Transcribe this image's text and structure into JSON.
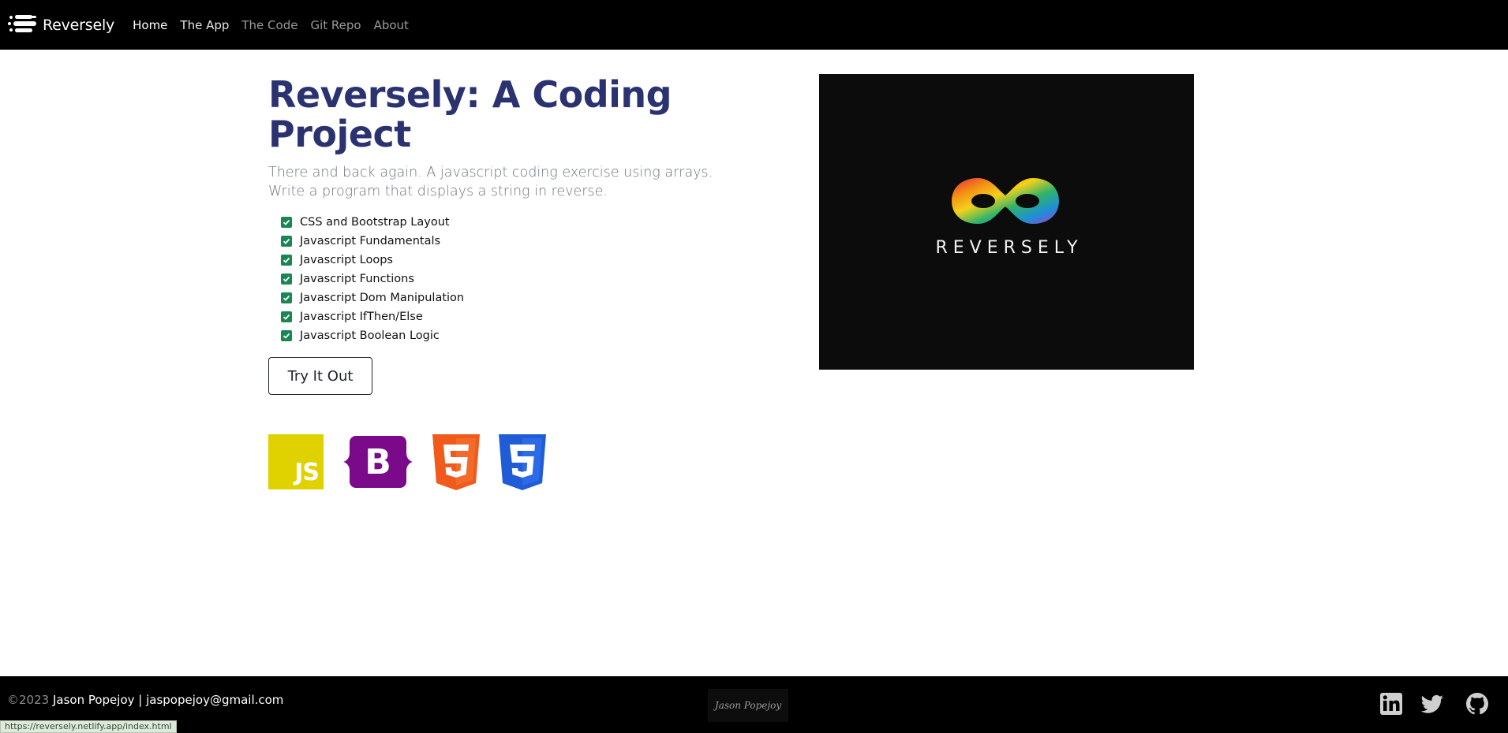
{
  "navbar": {
    "brand": "Reversely",
    "links": [
      {
        "label": "Home"
      },
      {
        "label": "The App"
      },
      {
        "label": "The Code"
      },
      {
        "label": "Git Repo"
      },
      {
        "label": "About"
      }
    ]
  },
  "hero": {
    "title": "Reversely: A Coding Project",
    "lead": "There and back again. A javascript coding exercise using arrays. Write a program that displays a string in reverse.",
    "skills": [
      "CSS and Bootstrap Layout",
      "Javascript Fundamentals",
      "Javascript Loops",
      "Javascript Functions",
      "Javascript Dom Manipulation",
      "Javascript IfThen/Else",
      "Javascript Boolean Logic"
    ],
    "button_label": "Try It Out",
    "tech_icons": [
      "javascript-icon",
      "bootstrap-icon",
      "html5-icon",
      "css3-icon"
    ],
    "js_icon_text": "JS",
    "bs_icon_text": "B",
    "image_logo_text": "REVERSELY"
  },
  "footer": {
    "copyright": "©2023",
    "author": "Jason Popejoy | jaspopejoy@gmail.com",
    "signature": "Jason Popejoy",
    "social_icons": [
      "linkedin-icon",
      "twitter-icon",
      "github-icon"
    ]
  },
  "status_bar": {
    "url": "https://reversely.netlify.app/index.html"
  },
  "colors": {
    "title": "#2b3270",
    "check": "#198754",
    "js": "#dfd200",
    "bootstrap": "#7a0a8a",
    "html5": "#f05a1b",
    "css3": "#1f5cd6"
  }
}
